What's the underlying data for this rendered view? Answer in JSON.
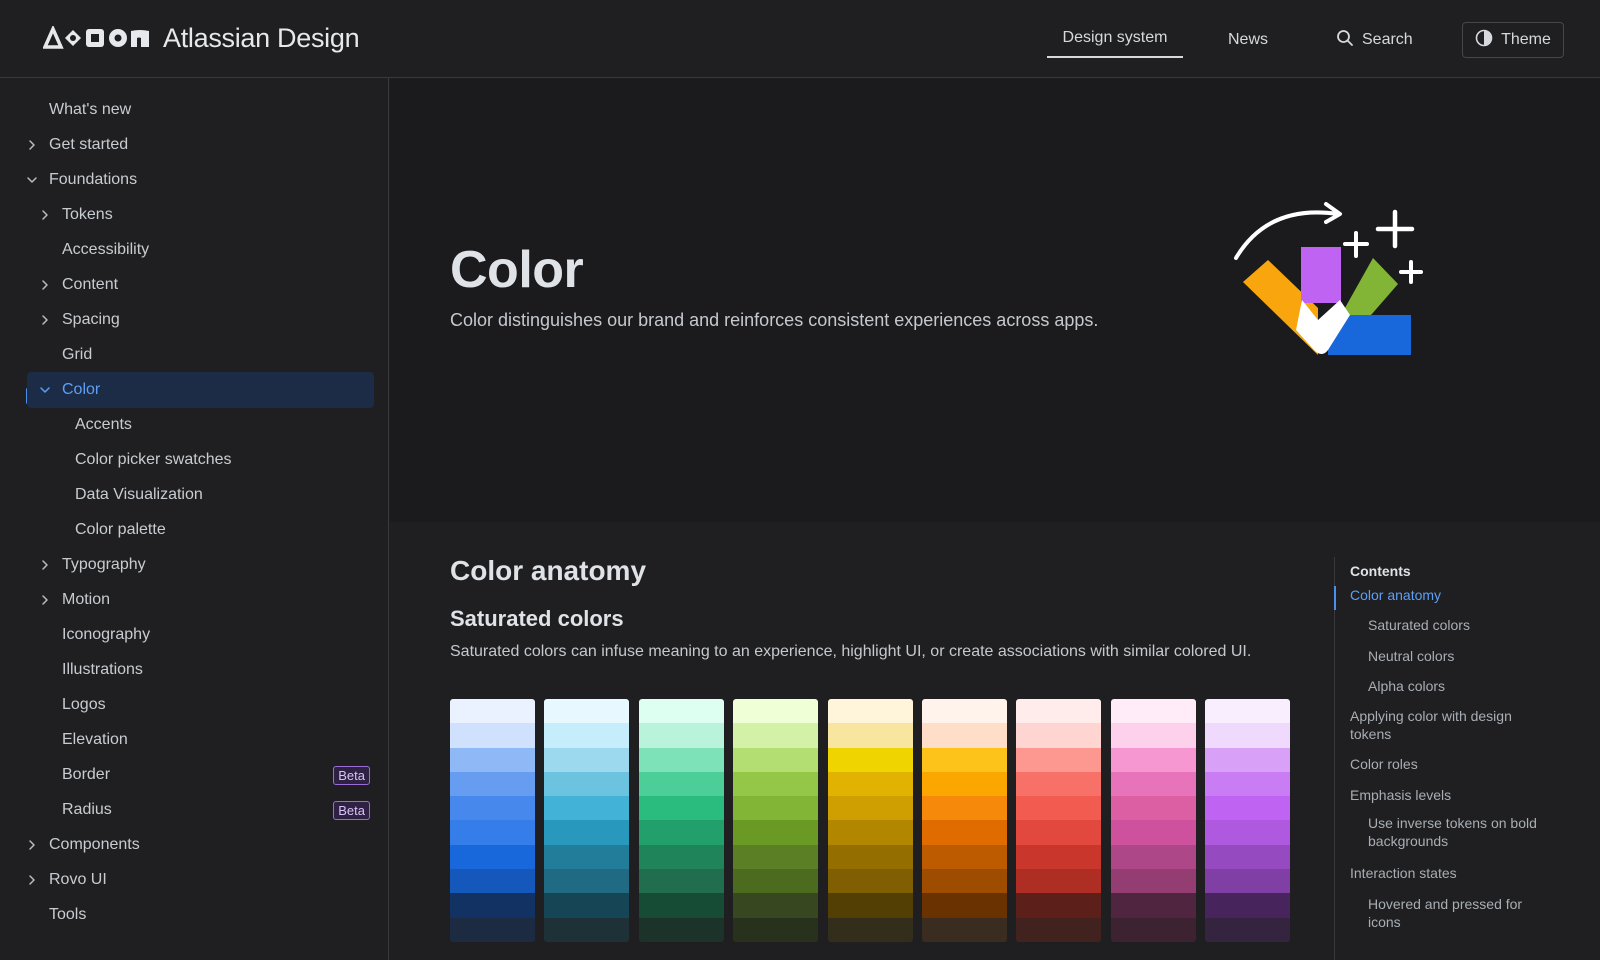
{
  "header": {
    "logo_text": "Atlassian Design",
    "nav": {
      "design_system": "Design system",
      "news": "News",
      "search": "Search",
      "theme": "Theme"
    }
  },
  "sidebar": {
    "items": [
      {
        "label": "What's new"
      },
      {
        "label": "Get started"
      },
      {
        "label": "Foundations"
      },
      {
        "label": "Tokens"
      },
      {
        "label": "Accessibility"
      },
      {
        "label": "Content"
      },
      {
        "label": "Spacing"
      },
      {
        "label": "Grid"
      },
      {
        "label": "Color"
      },
      {
        "label": "Accents"
      },
      {
        "label": "Color picker swatches"
      },
      {
        "label": "Data Visualization"
      },
      {
        "label": "Color palette"
      },
      {
        "label": "Typography"
      },
      {
        "label": "Motion"
      },
      {
        "label": "Iconography"
      },
      {
        "label": "Illustrations"
      },
      {
        "label": "Logos"
      },
      {
        "label": "Elevation"
      },
      {
        "label": "Border",
        "badge": "Beta"
      },
      {
        "label": "Radius",
        "badge": "Beta"
      },
      {
        "label": "Components"
      },
      {
        "label": "Rovo UI"
      },
      {
        "label": "Tools"
      }
    ]
  },
  "hero": {
    "title": "Color",
    "description": "Color distinguishes our brand and reinforces consistent experiences across apps."
  },
  "main": {
    "section_title": "Color anatomy",
    "subsection_title": "Saturated colors",
    "paragraph": "Saturated colors can infuse meaning to an experience, highlight UI, or create associations with similar colored UI.",
    "palettes": [
      [
        "#e9f2fe",
        "#cfe1fd",
        "#8fb8f6",
        "#669df1",
        "#4688ec",
        "#357de8",
        "#1868db",
        "#1558bc",
        "#123263",
        "#1c2b42"
      ],
      [
        "#e7f8ff",
        "#c6edfb",
        "#9dd9ee",
        "#6cc3e0",
        "#42b2d7",
        "#2898bd",
        "#227d9b",
        "#206a83",
        "#164555",
        "#1e3137"
      ],
      [
        "#dcfff1",
        "#baf3db",
        "#7ee2b8",
        "#4bce97",
        "#2abb7f",
        "#22a06b",
        "#1f845a",
        "#216e4e",
        "#164b35",
        "#1c3329"
      ],
      [
        "#efffd6",
        "#d3f1a7",
        "#b3df72",
        "#94c748",
        "#82b536",
        "#6a9a23",
        "#5b7f24",
        "#4c6b1f",
        "#37471f",
        "#28311b"
      ],
      [
        "#fff5db",
        "#f8e6a0",
        "#f0d400",
        "#e2b203",
        "#cf9f02",
        "#b38600",
        "#946f00",
        "#7f5f01",
        "#533f04",
        "#332e1b"
      ],
      [
        "#fff3eb",
        "#fedec8",
        "#fdc31a",
        "#fca700",
        "#f68909",
        "#e06c00",
        "#bd5b00",
        "#9e4c00",
        "#693200",
        "#3a2c1f"
      ],
      [
        "#ffeceb",
        "#ffd5d2",
        "#fd9891",
        "#f87168",
        "#f15b50",
        "#e2483d",
        "#c9372c",
        "#ae2e24",
        "#5d1f1a",
        "#42221f"
      ],
      [
        "#ffecf8",
        "#fdd0ec",
        "#f797d2",
        "#e774bb",
        "#dc5fa4",
        "#cd519d",
        "#ae4787",
        "#943d73",
        "#50253f",
        "#3d2232"
      ],
      [
        "#f8eefe",
        "#efd9fd",
        "#d8a0f7",
        "#c97cf4",
        "#bf63f3",
        "#af59e1",
        "#964ac0",
        "#803fa5",
        "#48245d",
        "#35243f"
      ]
    ]
  },
  "toc": {
    "heading": "Contents",
    "items": [
      {
        "label": "Color anatomy",
        "level": 1,
        "active": true
      },
      {
        "label": "Saturated colors",
        "level": 2
      },
      {
        "label": "Neutral colors",
        "level": 2
      },
      {
        "label": "Alpha colors",
        "level": 2
      },
      {
        "label": "Applying color with design tokens",
        "level": 1
      },
      {
        "label": "Color roles",
        "level": 1
      },
      {
        "label": "Emphasis levels",
        "level": 1
      },
      {
        "label": "Use inverse tokens on bold backgrounds",
        "level": 2
      },
      {
        "label": "Interaction states",
        "level": 1
      },
      {
        "label": "Hovered and pressed for icons",
        "level": 2
      }
    ]
  }
}
